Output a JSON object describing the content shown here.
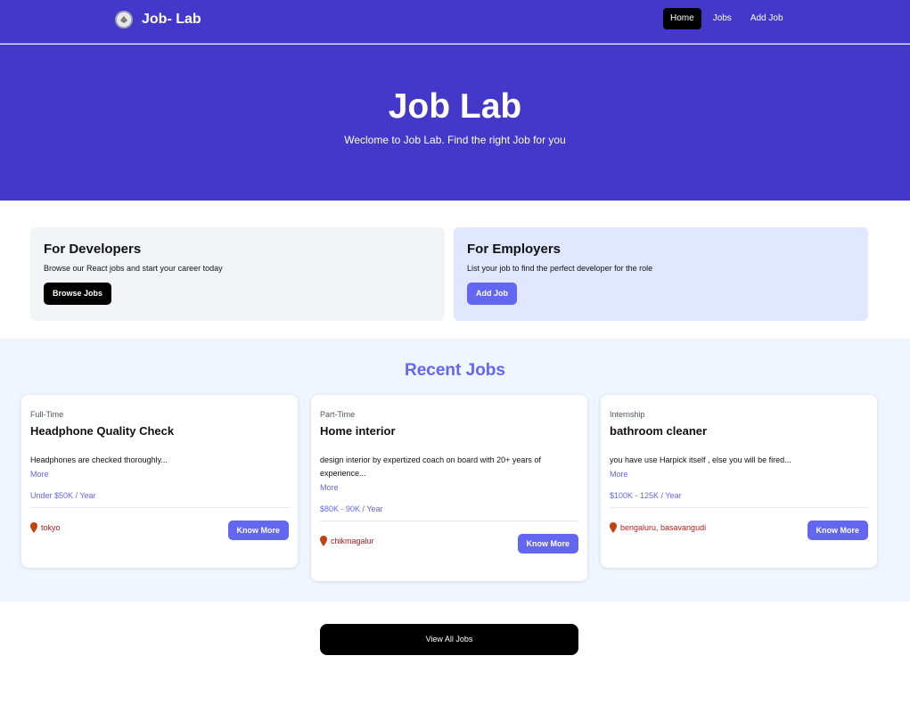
{
  "navbar": {
    "brand": "Job- Lab",
    "links": [
      "Home",
      "Jobs",
      "Add Job"
    ],
    "active": "Home",
    "color": "#4338ca"
  },
  "hero": {
    "title": "Job Lab",
    "subtitle": "Weclome to Job Lab. Find the right Job for you"
  },
  "cta": {
    "developers": {
      "title": "For Developers",
      "text": "Browse our React jobs and start your career today",
      "button": "Browse Jobs"
    },
    "employers": {
      "title": "For Employers",
      "text": "List your job to find the perfect developer for the role",
      "button": "Add Job"
    }
  },
  "recent": {
    "title": "Recent Jobs",
    "jobs": [
      {
        "type": "Full-Time",
        "title": "Headphone Quality Check",
        "description": "Headphones are checked thoroughly...",
        "more": "More",
        "salary": "Under $50K / Year",
        "location": "tokyo",
        "button": "Know More"
      },
      {
        "type": "Part-Time",
        "title": "Home interior",
        "description": "design interior by expertized coach on board with 20+ years of experience...",
        "more": "More",
        "salary": "$80K - 90K / Year",
        "location": "chikmagalur",
        "button": "Know More"
      },
      {
        "type": "Internship",
        "title": "bathroom cleaner",
        "description": "you have use Harpick itself , else you will be fired...",
        "more": "More",
        "salary": "$100K - 125K / Year",
        "location": "bengaluru, basavangudi",
        "button": "Know More"
      }
    ]
  },
  "footer": {
    "view_all": "View All Jobs"
  },
  "colors": {
    "accent": "#6366f1",
    "location": "#b91c1c"
  }
}
